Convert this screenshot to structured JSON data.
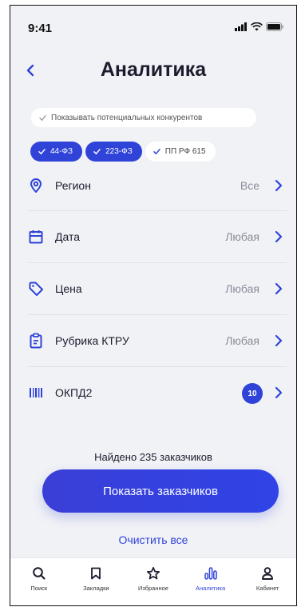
{
  "status": {
    "time": "9:41"
  },
  "header": {
    "title": "Аналитика"
  },
  "competitors_toggle": {
    "label": "Показывать потенциальных конкурентов"
  },
  "laws": [
    {
      "label": "44-ФЗ",
      "selected": true
    },
    {
      "label": "223-ФЗ",
      "selected": true
    },
    {
      "label": "ПП РФ 615",
      "selected": false
    }
  ],
  "filters": [
    {
      "icon": "location-pin-icon",
      "label": "Регион",
      "value": "Все"
    },
    {
      "icon": "calendar-icon",
      "label": "Дата",
      "value": "Любая"
    },
    {
      "icon": "price-tag-icon",
      "label": "Цена",
      "value": "Любая"
    },
    {
      "icon": "clipboard-icon",
      "label": "Рубрика КТРУ",
      "value": "Любая"
    },
    {
      "icon": "barcode-icon",
      "label": "ОКПД2",
      "badge": "10"
    }
  ],
  "result": {
    "found_text": "Найдено 235 заказчиков"
  },
  "actions": {
    "show_label": "Показать заказчиков",
    "clear_label": "Очистить все"
  },
  "tabs": [
    {
      "icon": "search-icon",
      "label": "Поиск",
      "active": false
    },
    {
      "icon": "bookmark-icon",
      "label": "Закладки",
      "active": false
    },
    {
      "icon": "star-icon",
      "label": "Избранное",
      "active": false
    },
    {
      "icon": "bar-chart-icon",
      "label": "Аналитика",
      "active": true
    },
    {
      "icon": "user-icon",
      "label": "Кабинет",
      "active": false
    }
  ],
  "colors": {
    "accent": "#2f43d8",
    "muted": "#8a8c99",
    "background": "#f1f2f6"
  }
}
